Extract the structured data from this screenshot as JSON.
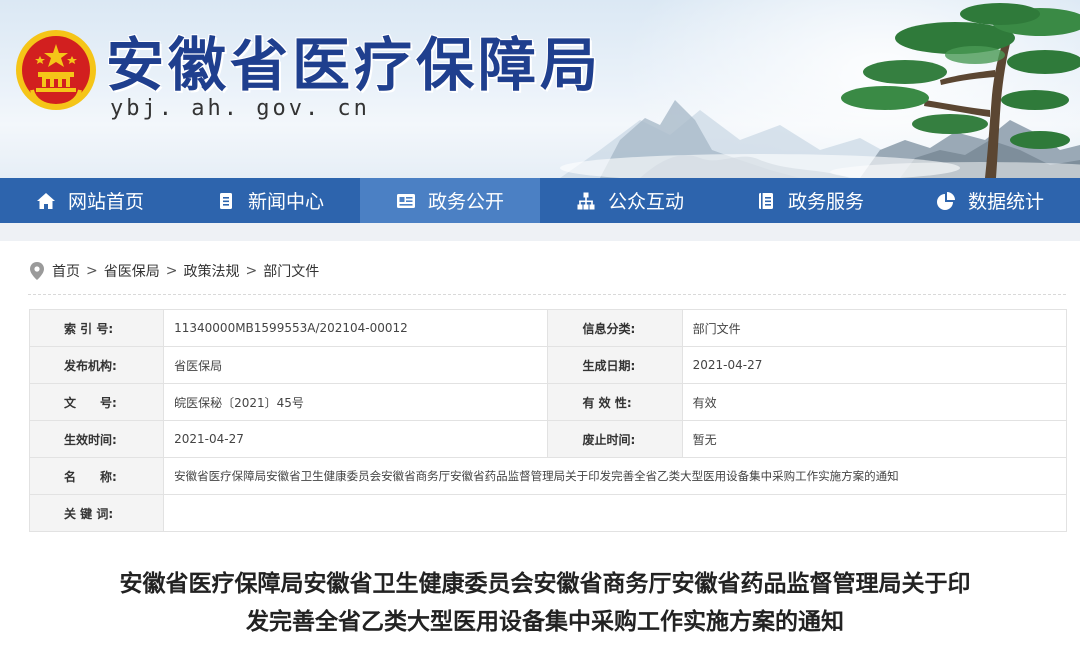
{
  "header": {
    "site_title": "安徽省医疗保障局",
    "site_url": "ybj. ah. gov. cn"
  },
  "nav": {
    "items": [
      {
        "label": "网站首页",
        "icon": "home-icon"
      },
      {
        "label": "新闻中心",
        "icon": "document-icon"
      },
      {
        "label": "政务公开",
        "icon": "news-board-icon",
        "active": true
      },
      {
        "label": "公众互动",
        "icon": "network-icon"
      },
      {
        "label": "政务服务",
        "icon": "service-book-icon"
      },
      {
        "label": "数据统计",
        "icon": "pie-chart-icon"
      }
    ]
  },
  "breadcrumb": {
    "items": [
      "首页",
      "省医保局",
      "政策法规",
      "部门文件"
    ],
    "separator": ">"
  },
  "info_table": {
    "index_label": "索 引 号:",
    "index_value": "11340000MB1599553A/202104-00012",
    "category_label": "信息分类:",
    "category_value": "部门文件",
    "publisher_label": "发布机构:",
    "publisher_value": "省医保局",
    "created_label": "生成日期:",
    "created_value": "2021-04-27",
    "docno_label": "文　　号:",
    "docno_value": "皖医保秘〔2021〕45号",
    "validity_label": "有 效 性:",
    "validity_value": "有效",
    "effective_label": "生效时间:",
    "effective_value": "2021-04-27",
    "repeal_label": "废止时间:",
    "repeal_value": "暂无",
    "name_label": "名　　称:",
    "name_value": "安徽省医疗保障局安徽省卫生健康委员会安徽省商务厅安徽省药品监督管理局关于印发完善全省乙类大型医用设备集中采购工作实施方案的通知",
    "keywords_label": "关 键 词:",
    "keywords_value": ""
  },
  "document": {
    "title_line1": "安徽省医疗保障局安徽省卫生健康委员会安徽省商务厅安徽省药品监督管理局关于印",
    "title_line2": "发完善全省乙类大型医用设备集中采购工作实施方案的通知"
  },
  "colors": {
    "nav_bg": "#2d64ad",
    "nav_active": "#4b80c4",
    "title_blue": "#1f3f8e",
    "emblem_red": "#d21f1f",
    "emblem_gold": "#f5c518"
  }
}
